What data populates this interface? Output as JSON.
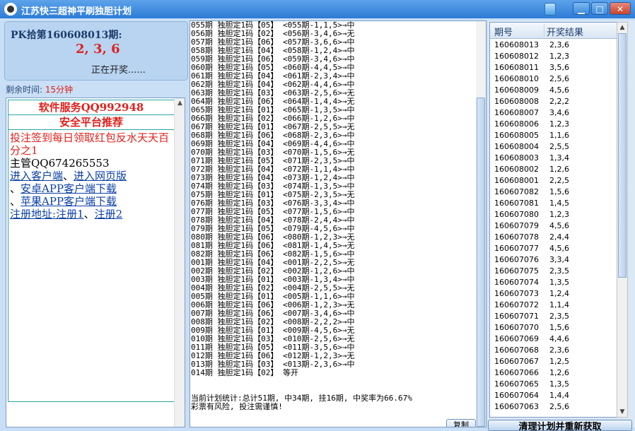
{
  "window": {
    "title": "江苏快三超神平刷独胆计划"
  },
  "window_controls": {
    "restore": "▁",
    "maximize": "□",
    "close": "✕"
  },
  "pk": {
    "title": "PK拾第160608013期:",
    "numbers": "2, 3, 6",
    "status": "正在开奖......"
  },
  "countdown": {
    "label": "剩余时间:",
    "value": "15分钟"
  },
  "promo": {
    "service": "软件服务QQ992948",
    "recommend": "安全平台推荐",
    "signup": "投注签到每日领取红包反水天天百分之1",
    "manager": "主管QQ674265553",
    "client_link": "进入客户端",
    "sep1": "、",
    "web_link": "进入网页版",
    "sep2": "、",
    "android_link": "安卓APP客户端下载",
    "sep3": "、",
    "apple_link": "苹果APP客户端下载",
    "register_label": "注册地址:",
    "register1": "注册1",
    "sep4": "、",
    "register2": "注册2"
  },
  "log": {
    "lines": [
      "055期 独胆定1码【05】 <055期-1,1,5>→中",
      "056期 独胆定1码【02】 <056期-3,4,6>→无",
      "057期 独胆定1码【06】 <057期-3,6,6>→中",
      "058期 独胆定1码【04】 <058期-1,2,4>→中",
      "059期 独胆定1码【06】 <059期-3,4,6>→中",
      "060期 独胆定1码【05】 <060期-4,4,5>→中",
      "061期 独胆定1码【04】 <061期-2,3,4>→中",
      "062期 独胆定1码【04】 <062期-4,4,6>→中",
      "063期 独胆定1码【03】 <063期-2,5,6>→无",
      "064期 独胆定1码【06】 <064期-1,4,4>→无",
      "065期 独胆定1码【01】 <065期-1,3,5>→中",
      "066期 独胆定1码【02】 <066期-1,2,6>→中",
      "067期 独胆定1码【01】 <067期-2,5,5>→无",
      "068期 独胆定1码【06】 <068期-2,3,6>→中",
      "069期 独胆定1码【04】 <069期-4,4,6>→中",
      "070期 独胆定1码【03】 <070期-1,5,6>→无",
      "071期 独胆定1码【05】 <071期-2,3,5>→中",
      "072期 独胆定1码【04】 <072期-1,1,4>→中",
      "073期 独胆定1码【04】 <073期-1,2,4>→中",
      "074期 独胆定1码【03】 <074期-1,3,5>→中",
      "075期 独胆定1码【01】 <075期-2,3,5>→无",
      "076期 独胆定1码【03】 <076期-3,3,4>→中",
      "077期 独胆定1码【05】 <077期-1,5,6>→中",
      "078期 独胆定1码【04】 <078期-2,4,4>→中",
      "079期 独胆定1码【05】 <079期-4,5,6>→中",
      "080期 独胆定1码【06】 <080期-1,2,3>→无",
      "081期 独胆定1码【06】 <081期-1,4,5>→无",
      "082期 独胆定1码【06】 <082期-1,5,6>→中",
      "001期 独胆定1码【04】 <001期-2,2,5>→无",
      "002期 独胆定1码【02】 <002期-1,2,6>→中",
      "003期 独胆定1码【01】 <003期-1,3,4>→中",
      "004期 独胆定1码【02】 <004期-2,5,5>→无",
      "005期 独胆定1码【01】 <005期-1,1,6>→中",
      "006期 独胆定1码【06】 <006期-1,2,3>→无",
      "007期 独胆定1码【06】 <007期-3,4,6>→中",
      "008期 独胆定1码【02】 <008期-2,2,2>→中",
      "009期 独胆定1码【01】 <009期-4,5,6>→无",
      "010期 独胆定1码【03】 <010期-2,5,6>→无",
      "011期 独胆定1码【05】 <011期-3,5,6>→中",
      "012期 独胆定1码【06】 <012期-1,2,3>→无",
      "013期 独胆定1码【03】 <013期-2,3,6>→中",
      "014期 独胆定1码【02】 等开"
    ],
    "stats": "当前计划统计:总计51期, 中34期, 挂16期, 中奖率为66.67%",
    "warning": "彩票有风险, 投注需谨慎!",
    "copy_label": "复制"
  },
  "results_table": {
    "columns": [
      "期号",
      "开奖结果"
    ],
    "rows": [
      [
        "160608013",
        "2,3,6"
      ],
      [
        "160608012",
        "1,2,3"
      ],
      [
        "160608011",
        "3,5,6"
      ],
      [
        "160608010",
        "2,5,6"
      ],
      [
        "160608009",
        "4,5,6"
      ],
      [
        "160608008",
        "2,2,2"
      ],
      [
        "160608007",
        "3,4,6"
      ],
      [
        "160608006",
        "1,2,3"
      ],
      [
        "160608005",
        "1,1,6"
      ],
      [
        "160608004",
        "2,5,5"
      ],
      [
        "160608003",
        "1,3,4"
      ],
      [
        "160608002",
        "1,2,6"
      ],
      [
        "160608001",
        "2,2,5"
      ],
      [
        "160607082",
        "1,5,6"
      ],
      [
        "160607081",
        "1,4,5"
      ],
      [
        "160607080",
        "1,2,3"
      ],
      [
        "160607079",
        "4,5,6"
      ],
      [
        "160607078",
        "2,4,4"
      ],
      [
        "160607077",
        "4,5,6"
      ],
      [
        "160607076",
        "3,3,4"
      ],
      [
        "160607075",
        "2,3,5"
      ],
      [
        "160607074",
        "1,3,5"
      ],
      [
        "160607073",
        "1,2,4"
      ],
      [
        "160607072",
        "1,1,4"
      ],
      [
        "160607071",
        "2,3,5"
      ],
      [
        "160607070",
        "1,5,6"
      ],
      [
        "160607069",
        "4,4,6"
      ],
      [
        "160607068",
        "2,3,6"
      ],
      [
        "160607067",
        "1,2,5"
      ],
      [
        "160607066",
        "1,2,6"
      ],
      [
        "160607065",
        "1,3,5"
      ],
      [
        "160607064",
        "1,4,4"
      ],
      [
        "160607063",
        "2,5,6"
      ]
    ]
  },
  "refresh_button": "清理计划并重新获取"
}
